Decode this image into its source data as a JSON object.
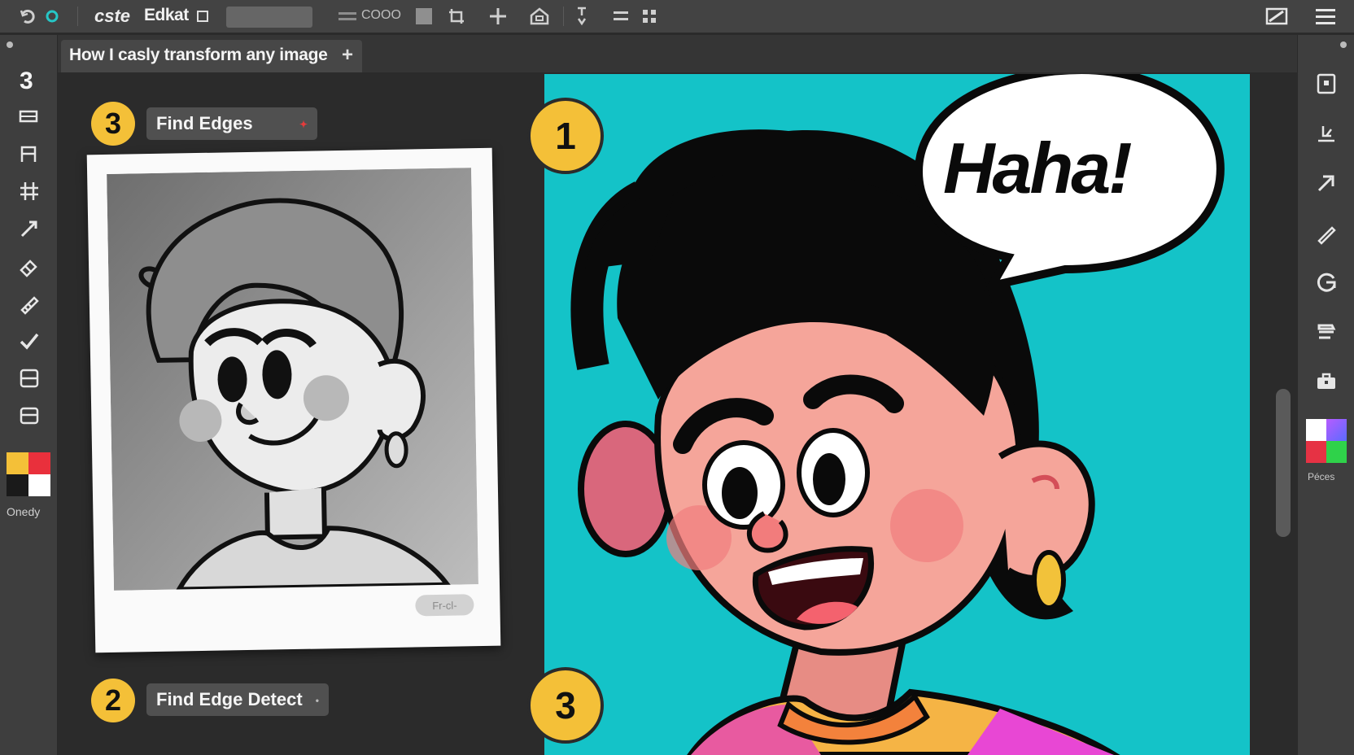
{
  "app": {
    "title": "Edkat",
    "zoom_text": "COOO"
  },
  "tab": {
    "label": "How I casly transform any image",
    "plus": "+"
  },
  "toolbar": {
    "icons": [
      "undo-icon",
      "sync-icon",
      "app-logo",
      "panel-icon",
      "mask-icon",
      "crop-icon",
      "move-icon",
      "home-icon",
      "adjust-icon",
      "align-icon",
      "grid-icon",
      "image-edit-icon",
      "menu-icon"
    ],
    "logo_text": "cste"
  },
  "left_tools": {
    "top_number": "3",
    "icons": [
      "marquee-icon",
      "text-icon",
      "crop-tool-icon",
      "brush-icon",
      "eraser-icon",
      "pencil-icon",
      "check-icon",
      "layers-icon",
      "layout-icon"
    ],
    "swatch_label": "Onedy",
    "colors": [
      "#f4c038",
      "#e9303c",
      "#1a1a1a",
      "#ffffff"
    ]
  },
  "right_tools": {
    "icons": [
      "frame-icon",
      "shape-icon",
      "arrow-icon",
      "pen-icon",
      "refresh-icon",
      "list-icon",
      "case-icon"
    ],
    "swatch_label": "Péces",
    "colors": [
      "#ffffff",
      "#b75cff",
      "#e63244",
      "#2fd24a"
    ]
  },
  "steps": [
    {
      "number": "3",
      "label": "Find Edges",
      "dot": "✦"
    },
    {
      "number": "2",
      "label": "Find Edge Detect",
      "dot": "•"
    }
  ],
  "canvas": {
    "badges": [
      "1",
      "3"
    ],
    "bubble_text": "Haha!",
    "background": "#14c3c8"
  },
  "sketch": {
    "button": "Fr-cl-"
  }
}
